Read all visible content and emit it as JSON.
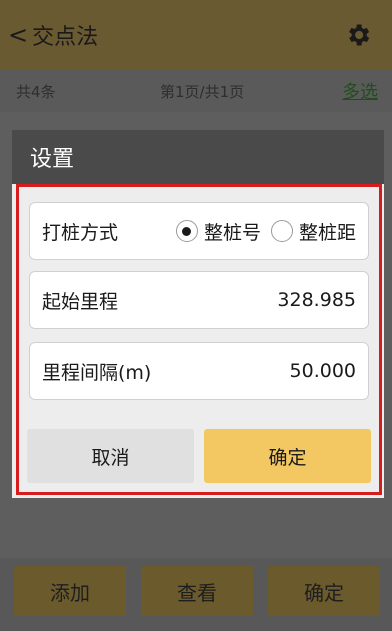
{
  "titlebar": {
    "back_glyph": "<",
    "title": "交点法",
    "settings_icon": "gear-icon"
  },
  "subbar": {
    "count": "共4条",
    "page": "第1页/共1页",
    "multi_select": "多选"
  },
  "bottom": {
    "add": "添加",
    "view": "查看",
    "confirm": "确定"
  },
  "dialog": {
    "title": "设置",
    "pile_mode": {
      "label": "打桩方式",
      "options": [
        "整桩号",
        "整桩距"
      ],
      "selected": "整桩号"
    },
    "start_mileage": {
      "label": "起始里程",
      "value": "328.985"
    },
    "interval": {
      "label": "里程间隔(m)",
      "value": "50.000"
    },
    "cancel": "取消",
    "ok": "确定"
  },
  "colors": {
    "accent": "#f3c863",
    "highlight_border": "#d61c1c"
  }
}
